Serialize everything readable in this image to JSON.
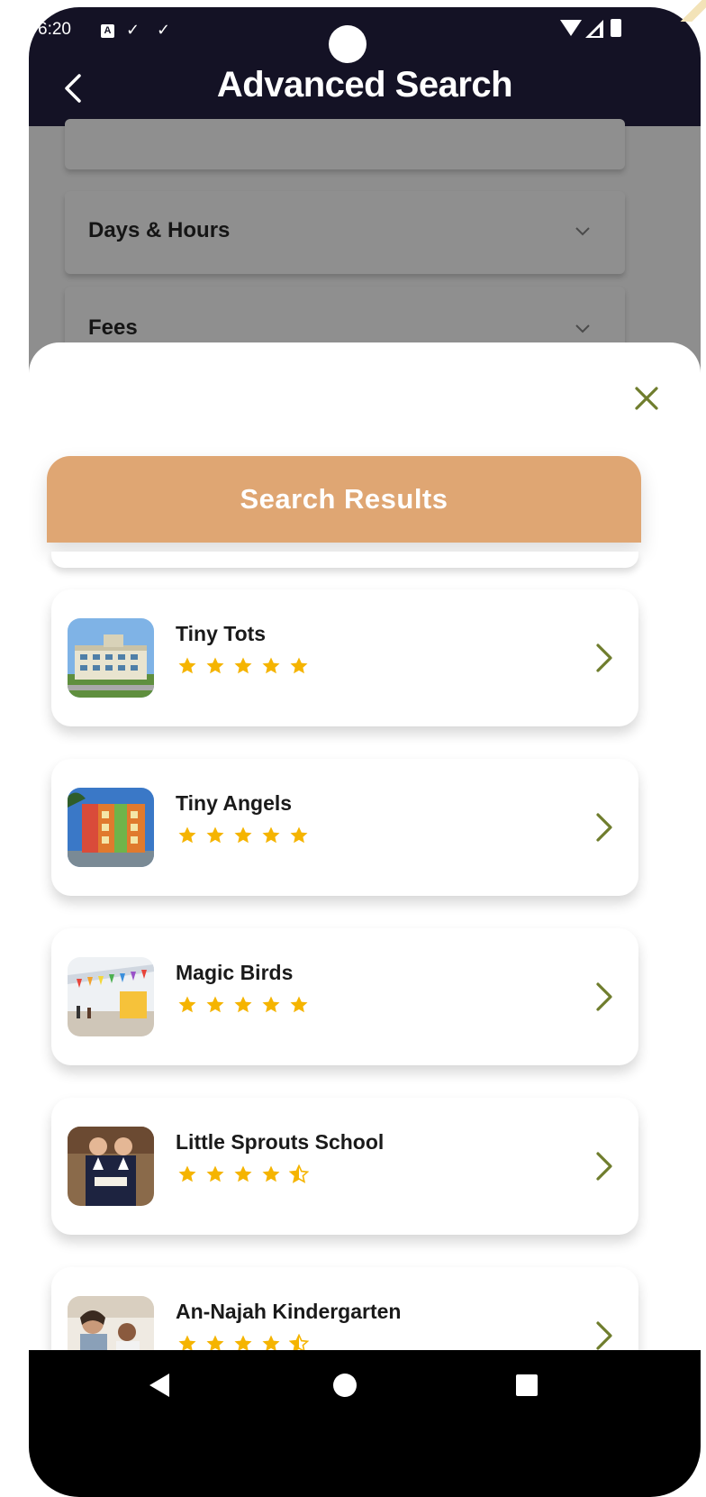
{
  "status_bar": {
    "time": "6:20",
    "notification_a": "A",
    "notification_check_1": "✓",
    "notification_check_2": "✓"
  },
  "header": {
    "title": "Advanced Search",
    "back_icon": "chevron-left-icon"
  },
  "background_form": {
    "fields": [
      {
        "label": "",
        "icon": "chevron-down-icon"
      },
      {
        "label": "Days & Hours",
        "icon": "chevron-down-icon"
      },
      {
        "label": "Fees",
        "icon": "chevron-down-icon"
      }
    ]
  },
  "sheet": {
    "close_icon": "close-icon",
    "results_title": "Search Results",
    "results": [
      {
        "name": "Tiny Tots",
        "rating": 5,
        "image": "building-photo"
      },
      {
        "name": "Tiny Angels",
        "rating": 5,
        "image": "colorful-building-photo"
      },
      {
        "name": "Magic Birds",
        "rating": 5,
        "image": "classroom-photo"
      },
      {
        "name": "Little Sprouts School",
        "rating": 4.5,
        "image": "students-photo"
      },
      {
        "name": "An-Najah Kindergarten",
        "rating": 4.5,
        "image": "kids-reading-photo"
      }
    ]
  },
  "colors": {
    "header_bg": "#141225",
    "accent_orange": "#dfa673",
    "star_gold": "#f5b400",
    "olive": "#6f7d2d",
    "navbar_bg": "#000000"
  },
  "nav_bar": {
    "back_icon": "nav-back-icon",
    "home_icon": "nav-home-icon",
    "recents_icon": "nav-recents-icon"
  }
}
